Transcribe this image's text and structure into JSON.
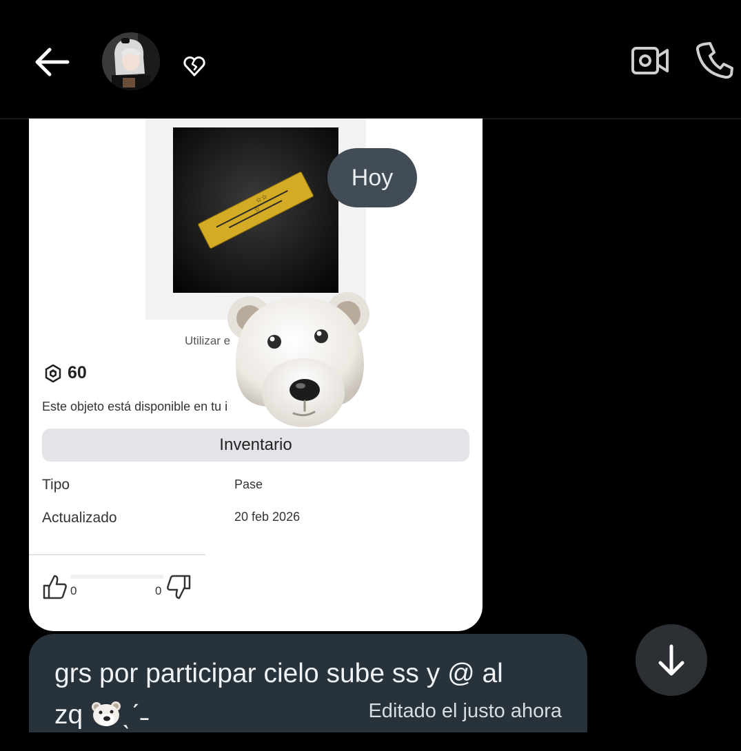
{
  "header": {
    "back_icon": "arrow-left-icon",
    "heart_icon": "heart-outline-icon",
    "video_icon": "video-call-icon",
    "phone_icon": "phone-icon"
  },
  "chat": {
    "date_separator": "Hoy",
    "shared_card": {
      "use_text": "Utilizar e",
      "price": "60",
      "price_icon": "robux-icon",
      "availability": "Este objeto está disponible en tu i",
      "inventory_button": "Inventario",
      "type_label": "Tipo",
      "type_value": "Pase",
      "updated_label": "Actualizado",
      "updated_value": "20 feb 2026",
      "likes": "0",
      "dislikes": "0"
    },
    "sticker": "polar-bear-sticker",
    "message": {
      "text_line1": "grs por participar cielo sube ss y @ al",
      "text_line2_prefix": "zq",
      "text_line2_suffix": "ˎˊ˗",
      "edited": "Editado el justo ahora"
    },
    "scroll_down_icon": "arrow-down-icon"
  },
  "colors": {
    "background": "#000000",
    "bubble": "#28323b",
    "date_pill": "#414c56",
    "card": "#ffffff",
    "gold": "#d4ab24"
  }
}
